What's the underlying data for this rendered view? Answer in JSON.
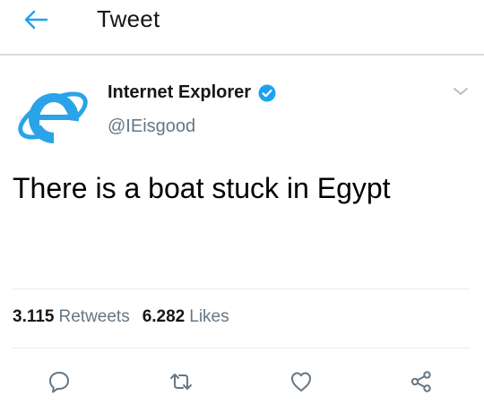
{
  "header": {
    "title": "Tweet",
    "back_icon": "arrow-left-icon"
  },
  "tweet": {
    "author_name": "Internet Explorer",
    "author_handle": "@IEisgood",
    "verified": true,
    "text": "There is a boat stuck in Egypt",
    "retweet_count": "3.115",
    "retweet_label": "Retweets",
    "like_count": "6.282",
    "like_label": "Likes"
  },
  "actions": [
    {
      "name": "reply",
      "icon": "comment-icon"
    },
    {
      "name": "retweet",
      "icon": "retweet-icon"
    },
    {
      "name": "like",
      "icon": "heart-icon"
    },
    {
      "name": "share",
      "icon": "share-icon"
    }
  ],
  "colors": {
    "accent": "#1da1f2",
    "icon_gray": "#657786",
    "ie_blue": "#2ba3e8"
  }
}
